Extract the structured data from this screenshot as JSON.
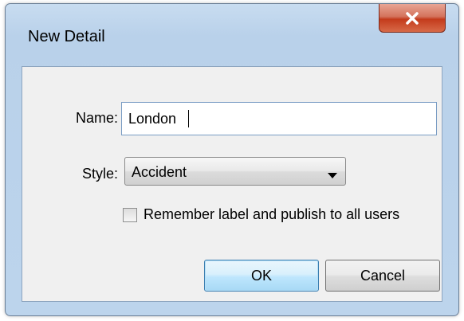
{
  "window": {
    "title": "New Detail"
  },
  "form": {
    "name_label": "Name:",
    "name_value": "London",
    "style_label": "Style:",
    "style_value": "Accident",
    "remember_label": "Remember label and publish to all users",
    "remember_checked": false
  },
  "buttons": {
    "ok_label": "OK",
    "cancel_label": "Cancel"
  },
  "icons": {
    "close": "close-icon",
    "dropdown": "chevron-down-icon"
  },
  "colors": {
    "close_button": "#c43b1c",
    "default_button_border": "#3c7fb1",
    "frame": "#b9d1ea"
  }
}
